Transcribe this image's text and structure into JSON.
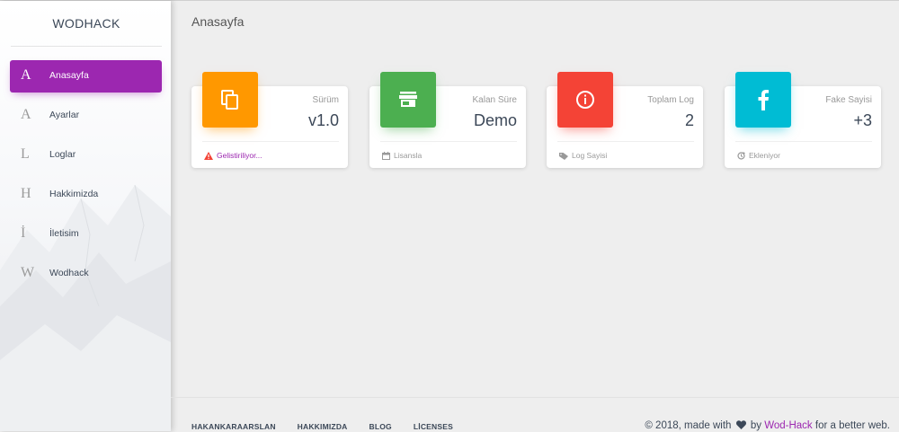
{
  "sidebar": {
    "brand": "WODHACK",
    "items": [
      {
        "letter": "A",
        "label": "Anasayfa",
        "active": true
      },
      {
        "letter": "A",
        "label": "Ayarlar"
      },
      {
        "letter": "L",
        "label": "Loglar"
      },
      {
        "letter": "H",
        "label": "Hakkimizda"
      },
      {
        "letter": "İ",
        "label": "İletisim"
      },
      {
        "letter": "W",
        "label": "Wodhack"
      }
    ]
  },
  "header": {
    "title": "Anasayfa"
  },
  "cards": [
    {
      "category": "Sürüm",
      "value": "v1.0",
      "footer": "Gelistiriliyor...",
      "icon": "copy-icon",
      "color": "#ff9800",
      "footer_icon": "warning-icon"
    },
    {
      "category": "Kalan Süre",
      "value": "Demo",
      "footer": "Lisansla",
      "icon": "store-icon",
      "color": "#4caf50",
      "footer_icon": "calendar-icon"
    },
    {
      "category": "Toplam Log",
      "value": "2",
      "footer": "Log Sayisi",
      "icon": "info-icon",
      "color": "#f44336",
      "footer_icon": "tag-icon"
    },
    {
      "category": "Fake Sayisi",
      "value": "+3",
      "footer": "Ekleniyor",
      "icon": "facebook-icon",
      "color": "#00bcd4",
      "footer_icon": "update-icon"
    }
  ],
  "footer": {
    "links": [
      "HAKANKARAARSLAN",
      "HAKKIMIZDA",
      "BLOG",
      "LİCENSES"
    ],
    "copyright_prefix": "© 2018, made with",
    "copyright_by": "by",
    "copyright_brand": "Wod-Hack",
    "copyright_suffix": "for a better web."
  },
  "colors": {
    "accent": "#9c27b0",
    "text": "#3c4858",
    "muted": "#999999",
    "warning": "#f44336"
  }
}
